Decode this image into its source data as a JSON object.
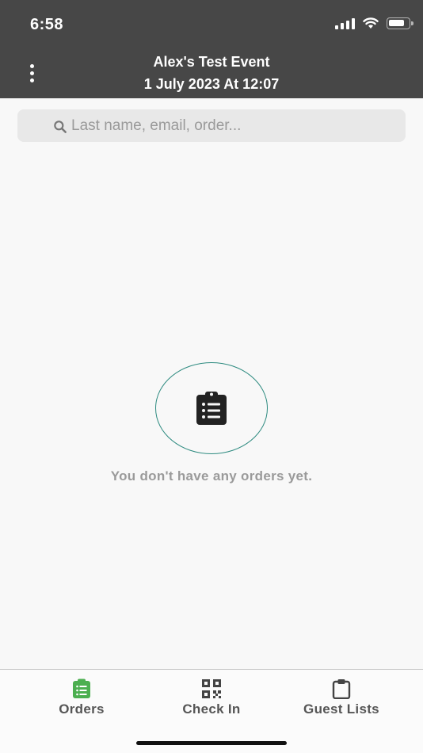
{
  "status_bar": {
    "time": "6:58"
  },
  "header": {
    "event_name": "Alex's Test Event",
    "event_date": "1 July 2023 At 12:07"
  },
  "search": {
    "placeholder": "Last name, email, order...",
    "value": ""
  },
  "empty_state": {
    "message": "You don't have any orders yet."
  },
  "tabs": [
    {
      "label": "Orders",
      "icon": "clipboard-list-icon",
      "active": true
    },
    {
      "label": "Check In",
      "icon": "qr-code-icon",
      "active": false
    },
    {
      "label": "Guest Lists",
      "icon": "clipboard-icon",
      "active": false
    }
  ],
  "colors": {
    "header_bg": "#474747",
    "accent_green": "#4caf50",
    "circle_teal": "#2e8b80",
    "muted_text": "#9a9a9a"
  }
}
